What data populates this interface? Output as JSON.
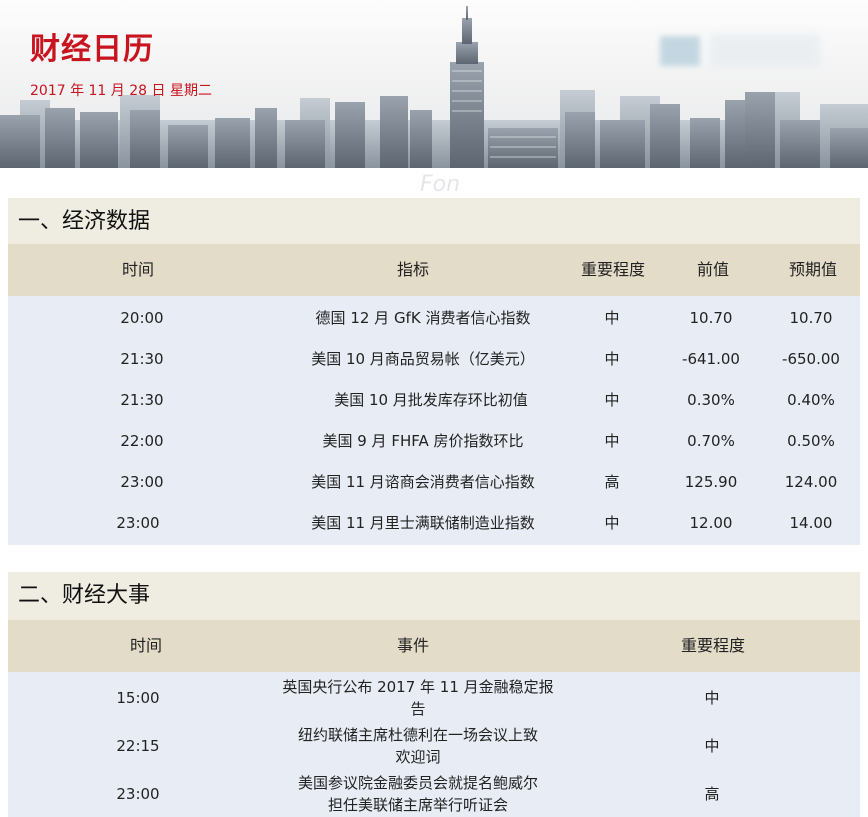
{
  "header": {
    "title": "财经日历",
    "date": "2017 年 11 月 28 日  星期二"
  },
  "watermark": "Fon",
  "economic": {
    "section_title": "一、经济数据",
    "columns": [
      "时间",
      "指标",
      "重要程度",
      "前值",
      "预期值"
    ],
    "rows": [
      {
        "time": "20:00",
        "indicator": "德国 12 月 GfK 消费者信心指数",
        "importance": "中",
        "previous": "10.70",
        "forecast": "10.70"
      },
      {
        "time": "21:30",
        "indicator": "美国 10 月商品贸易帐（亿美元）",
        "importance": "中",
        "previous": "-641.00",
        "forecast": "-650.00"
      },
      {
        "time": "21:30",
        "indicator": "美国 10 月批发库存环比初值",
        "importance": "中",
        "previous": "0.30%",
        "forecast": "0.40%"
      },
      {
        "time": "22:00",
        "indicator": "美国 9 月 FHFA 房价指数环比",
        "importance": "中",
        "previous": "0.70%",
        "forecast": "0.50%"
      },
      {
        "time": "23:00",
        "indicator": "美国 11 月谘商会消费者信心指数",
        "importance": "高",
        "previous": "125.90",
        "forecast": "124.00"
      },
      {
        "time": "23:00",
        "indicator": "美国 11 月里士满联储制造业指数",
        "importance": "中",
        "previous": "12.00",
        "forecast": "14.00"
      }
    ]
  },
  "events": {
    "section_title": "二、财经大事",
    "columns": [
      "时间",
      "事件",
      "重要程度"
    ],
    "rows": [
      {
        "time": "15:00",
        "event_line1": "英国央行公布 2017 年 11 月金融稳定报",
        "event_line2": "告",
        "importance": "中"
      },
      {
        "time": "22:15",
        "event_line1": "纽约联储主席杜德利在一场会议上致",
        "event_line2": "欢迎词",
        "importance": "中"
      },
      {
        "time": "23:00",
        "event_line1": "美国参议院金融委员会就提名鲍威尔",
        "event_line2": "担任美联储主席举行听证会",
        "importance": "高"
      }
    ]
  },
  "colors": {
    "title_red": "#c8141e",
    "section_bg": "#efece2",
    "column_header_bg": "#e3dcc8",
    "body_bg": "#e8edf5"
  }
}
